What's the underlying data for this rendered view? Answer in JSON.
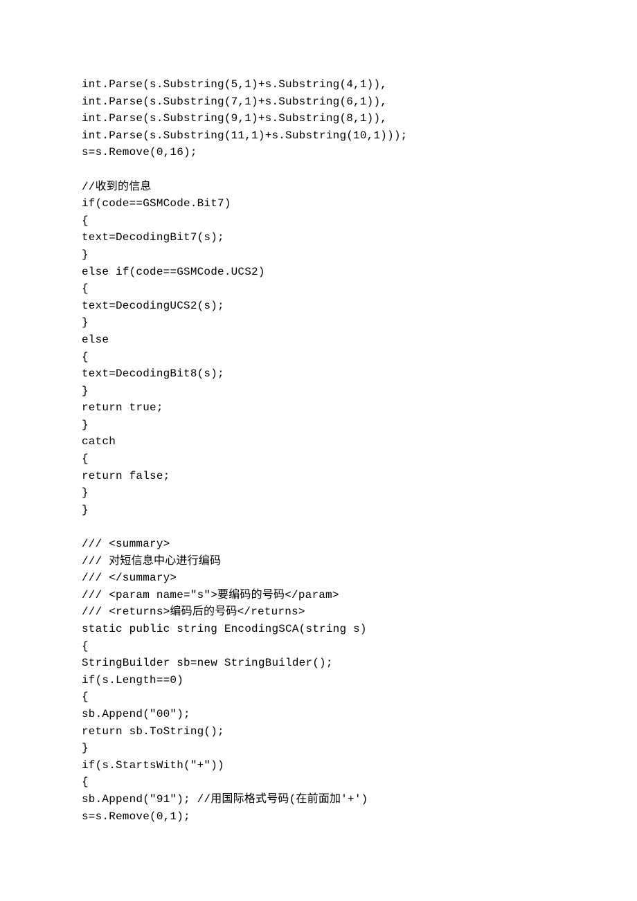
{
  "lines": [
    "int.Parse(s.Substring(5,1)+s.Substring(4,1)),",
    "int.Parse(s.Substring(7,1)+s.Substring(6,1)),",
    "int.Parse(s.Substring(9,1)+s.Substring(8,1)),",
    "int.Parse(s.Substring(11,1)+s.Substring(10,1)));",
    "s=s.Remove(0,16);",
    "",
    "//收到的信息",
    "if(code==GSMCode.Bit7)",
    "{",
    "text=DecodingBit7(s);",
    "}",
    "else if(code==GSMCode.UCS2)",
    "{",
    "text=DecodingUCS2(s);",
    "}",
    "else",
    "{",
    "text=DecodingBit8(s);",
    "}",
    "return true;",
    "}",
    "catch",
    "{",
    "return false;",
    "}",
    "}",
    "",
    "/// <summary>",
    "/// 对短信息中心进行编码",
    "/// </summary>",
    "/// <param name=\"s\">要编码的号码</param>",
    "/// <returns>编码后的号码</returns>",
    "static public string EncodingSCA(string s)",
    "{",
    "StringBuilder sb=new StringBuilder();",
    "if(s.Length==0)",
    "{",
    "sb.Append(\"00\");",
    "return sb.ToString();",
    "}",
    "if(s.StartsWith(\"+\"))",
    "{",
    "sb.Append(\"91\"); //用国际格式号码(在前面加'+')",
    "s=s.Remove(0,1);"
  ]
}
